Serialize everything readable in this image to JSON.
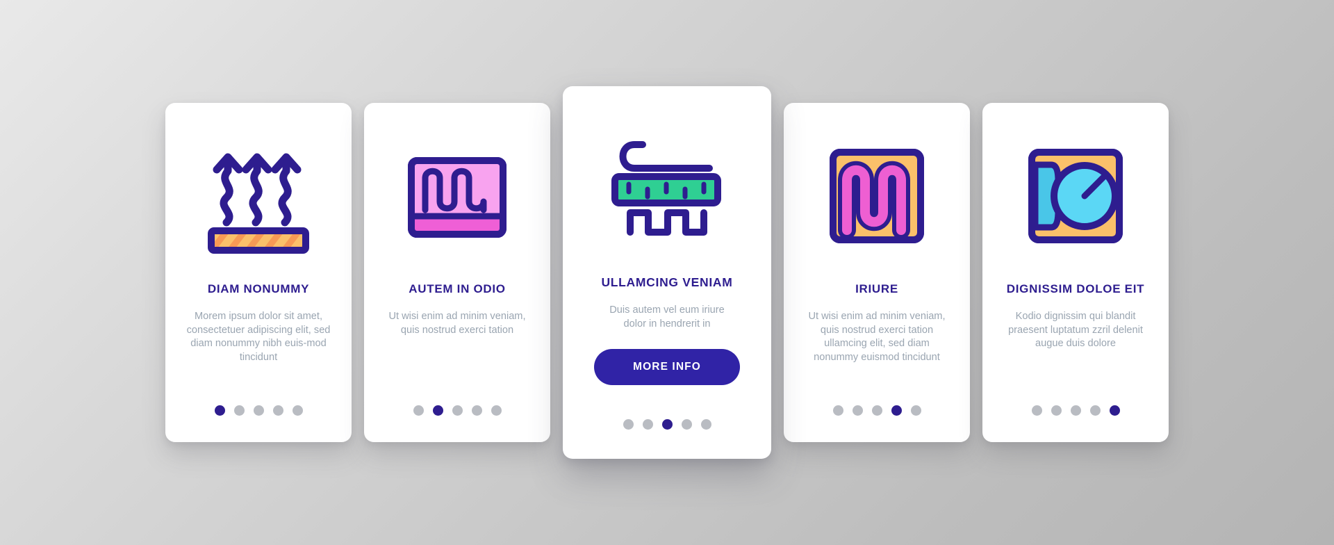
{
  "theme": {
    "accent": "#2e1d8f",
    "button_bg": "#3023a6",
    "dot_inactive": "#b9bcc2",
    "dot_active": "#2e1d8f",
    "body_text": "#9aa5b1",
    "card_bg": "#ffffff",
    "background": "#c9c9c9",
    "icon_stroke": "#2e1d8f",
    "icon_orange": "#fbc06a",
    "icon_orange_dark": "#f79a55",
    "icon_pink": "#f8a3ef",
    "icon_pink_dark": "#ef5fd6",
    "icon_magenta": "#ee5fd2",
    "icon_green": "#2fcf93",
    "icon_cyan": "#5bd7f5",
    "icon_cyan_dark": "#49c6e8"
  },
  "cards": [
    {
      "icon": "heat-rising-floor-icon",
      "title": "DIAM NONUMMY",
      "description": "Morem ipsum dolor sit amet, consectetuer adipiscing elit, sed diam nonummy nibh euis-mod tincidunt",
      "dots": 5,
      "active_dot": 1,
      "has_button": false
    },
    {
      "icon": "heating-panel-coil-icon",
      "title": "AUTEM IN ODIO",
      "description": "Ut wisi enim ad minim veniam, quis nostrud exerci tation",
      "dots": 5,
      "active_dot": 2,
      "has_button": false
    },
    {
      "icon": "heating-element-cable-icon",
      "title": "ULLAMCING VENIAM",
      "description": "Duis autem vel eum iriure dolor in hendrerit in",
      "dots": 5,
      "active_dot": 3,
      "has_button": true,
      "button_label": "MORE INFO"
    },
    {
      "icon": "serpentine-heater-icon",
      "title": "IRIURE",
      "description": "Ut wisi enim ad minim veniam, quis nostrud exerci tation ullamcing elit, sed diam nonummy euismod tincidunt",
      "dots": 5,
      "active_dot": 4,
      "has_button": false
    },
    {
      "icon": "thermostat-dial-icon",
      "title": "DIGNISSIM DOLOE EIT",
      "description": "Kodio dignissim qui blandit praesent luptatum zzril delenit augue duis dolore",
      "dots": 5,
      "active_dot": 5,
      "has_button": false
    }
  ]
}
